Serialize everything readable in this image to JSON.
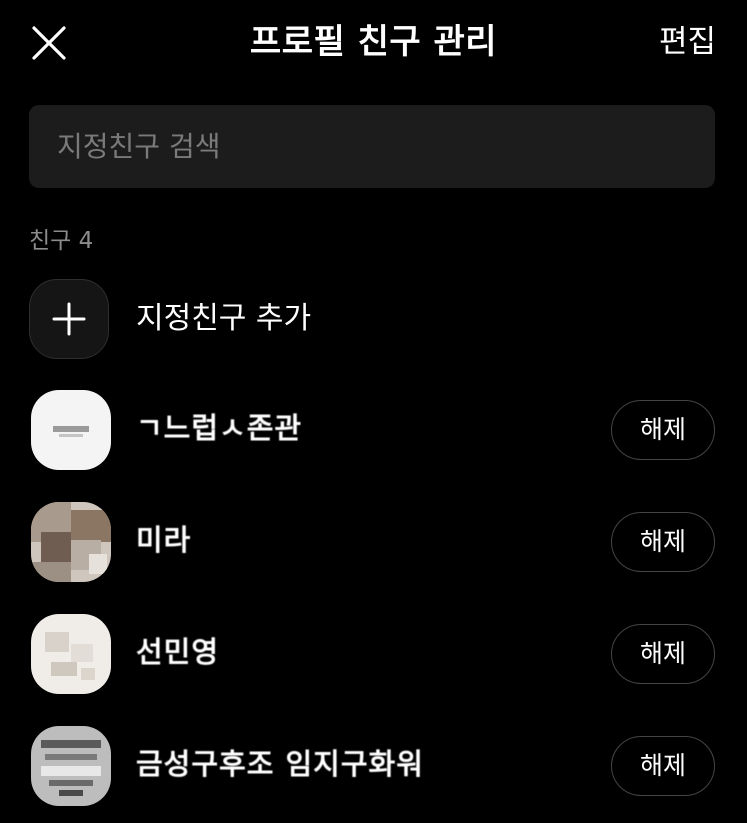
{
  "header": {
    "title": "프로필 친구 관리",
    "edit_label": "편집"
  },
  "search": {
    "placeholder": "지정친구 검색",
    "value": ""
  },
  "section": {
    "label": "친구 4"
  },
  "add_friend": {
    "label": "지정친구 추가"
  },
  "friends": [
    {
      "name": "ㄱ느럽ㅅ존관",
      "button_label": "해제",
      "avatar_icon": "white-logo-avatar"
    },
    {
      "name": "미라",
      "button_label": "해제",
      "avatar_icon": "photo-avatar"
    },
    {
      "name": "선민영",
      "button_label": "해제",
      "avatar_icon": "light-sketch-avatar"
    },
    {
      "name": "금성구후조 임지구화워",
      "button_label": "해제",
      "avatar_icon": "gray-poster-avatar"
    }
  ],
  "colors": {
    "background": "#000000",
    "search_bg": "#1c1c1c",
    "placeholder": "#7a7a7a",
    "section_label": "#8c8c8c",
    "button_border": "#444444"
  }
}
